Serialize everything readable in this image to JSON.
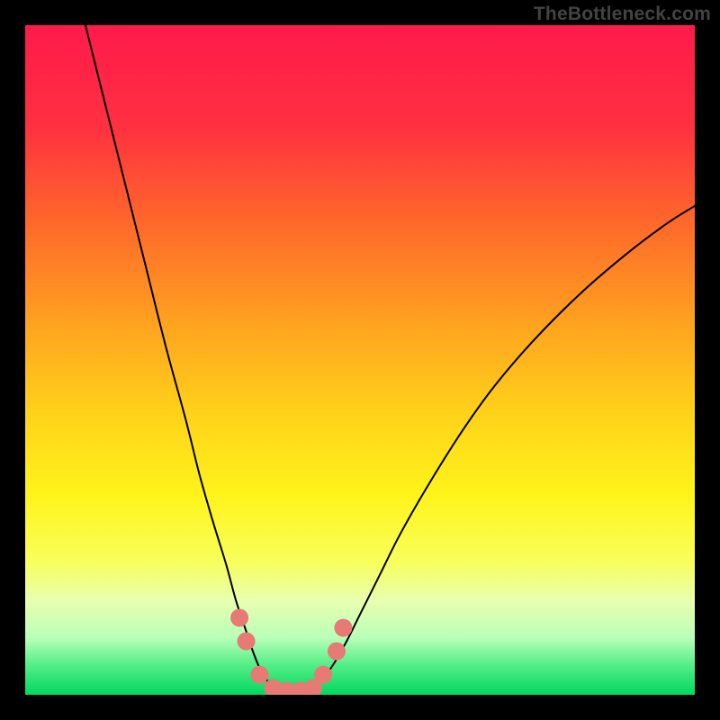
{
  "watermark": "TheBottleneck.com",
  "chart_data": {
    "type": "line",
    "title": "",
    "xlabel": "",
    "ylabel": "",
    "xlim": [
      0,
      100
    ],
    "ylim": [
      0,
      100
    ],
    "grid": false,
    "legend": false,
    "background_gradient_stops": [
      {
        "offset": 0.0,
        "color": "#ff1a4b"
      },
      {
        "offset": 0.15,
        "color": "#ff3040"
      },
      {
        "offset": 0.3,
        "color": "#ff6a2a"
      },
      {
        "offset": 0.45,
        "color": "#ffa41f"
      },
      {
        "offset": 0.58,
        "color": "#ffd21a"
      },
      {
        "offset": 0.7,
        "color": "#fff31a"
      },
      {
        "offset": 0.8,
        "color": "#f8ff5a"
      },
      {
        "offset": 0.86,
        "color": "#e8ffb0"
      },
      {
        "offset": 0.915,
        "color": "#b8ffb8"
      },
      {
        "offset": 0.955,
        "color": "#55ee88"
      },
      {
        "offset": 1.0,
        "color": "#00d860"
      }
    ],
    "series": [
      {
        "name": "left-arm",
        "color": "#000000",
        "width": 2,
        "x": [
          9.0,
          12.0,
          15.0,
          18.0,
          21.0,
          24.0,
          26.0,
          28.0,
          30.0,
          31.5,
          33.0,
          34.0,
          35.0,
          36.0,
          37.0
        ],
        "y": [
          100.0,
          88.0,
          76.0,
          64.0,
          52.0,
          41.0,
          33.0,
          26.0,
          19.5,
          14.0,
          9.5,
          6.5,
          4.0,
          2.3,
          1.2
        ]
      },
      {
        "name": "right-arm",
        "color": "#000000",
        "width": 2,
        "x": [
          43.0,
          44.5,
          46.0,
          48.0,
          50.0,
          53.0,
          56.0,
          60.0,
          65.0,
          70.0,
          76.0,
          83.0,
          90.0,
          96.0,
          100.0
        ],
        "y": [
          1.2,
          2.5,
          4.5,
          8.0,
          12.0,
          18.0,
          24.0,
          31.0,
          39.0,
          46.0,
          53.0,
          60.0,
          66.0,
          70.5,
          73.0
        ]
      },
      {
        "name": "valley-markers",
        "type": "scatter",
        "color": "#e77a74",
        "marker_radius": 10,
        "x": [
          32.0,
          33.0,
          35.0,
          37.0,
          39.0,
          41.0,
          43.0,
          44.5,
          46.5,
          47.5
        ],
        "y": [
          11.5,
          8.0,
          3.0,
          1.0,
          0.6,
          0.6,
          1.0,
          3.0,
          6.5,
          10.0
        ]
      }
    ]
  }
}
